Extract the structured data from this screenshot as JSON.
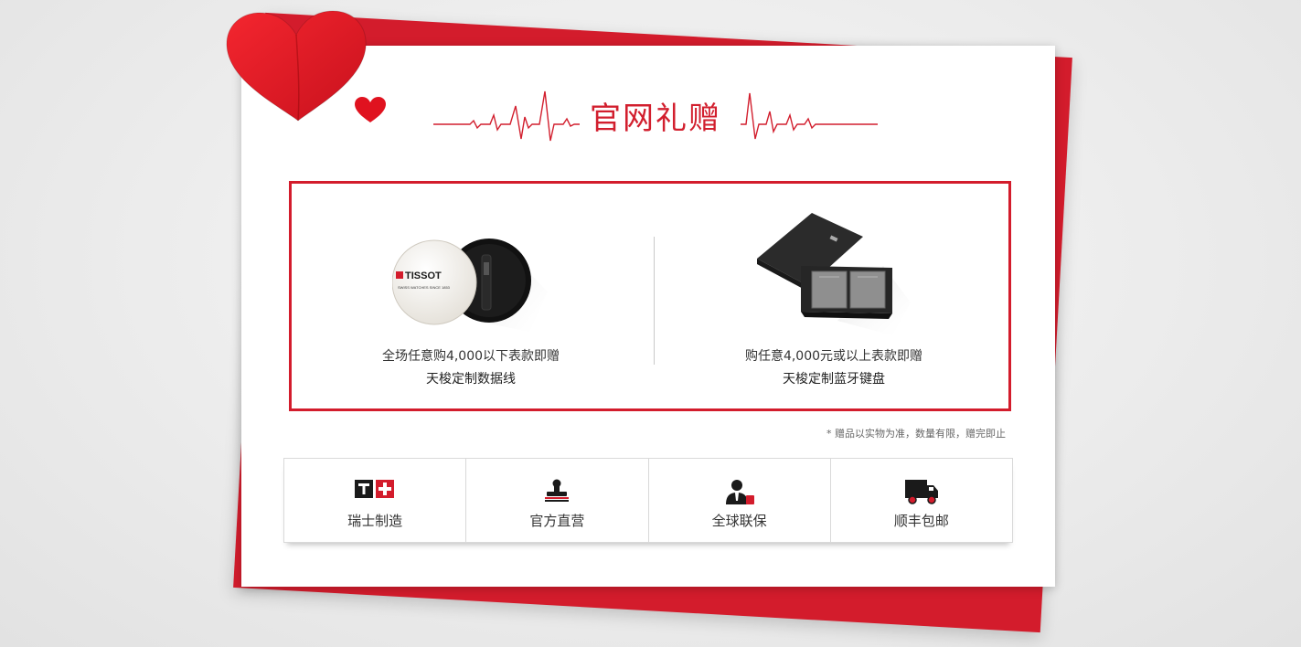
{
  "header": {
    "title": "官网礼赠"
  },
  "gifts": [
    {
      "line1": "全场任意购4,000以下表款即赠",
      "line2": "天梭定制数据线",
      "image_icon": "tissot-cable-icon",
      "brand_text": "TISSOT",
      "brand_sub": "SWISS WATCHES SINCE 1853"
    },
    {
      "line1": "购任意4,000元或以上表款即赠",
      "line2": "天梭定制蓝牙键盘",
      "image_icon": "keyboard-box-icon"
    }
  ],
  "note": "* 赠品以实物为准，数量有限，赠完即止",
  "features": [
    {
      "label": "瑞士制造",
      "icon": "swiss-t-cross-icon"
    },
    {
      "label": "官方直营",
      "icon": "official-stamp-icon"
    },
    {
      "label": "全球联保",
      "icon": "service-person-icon"
    },
    {
      "label": "顺丰包邮",
      "icon": "delivery-truck-icon"
    }
  ],
  "colors": {
    "accent": "#d31c2c",
    "title": "#d21f2e",
    "text": "#333333"
  }
}
